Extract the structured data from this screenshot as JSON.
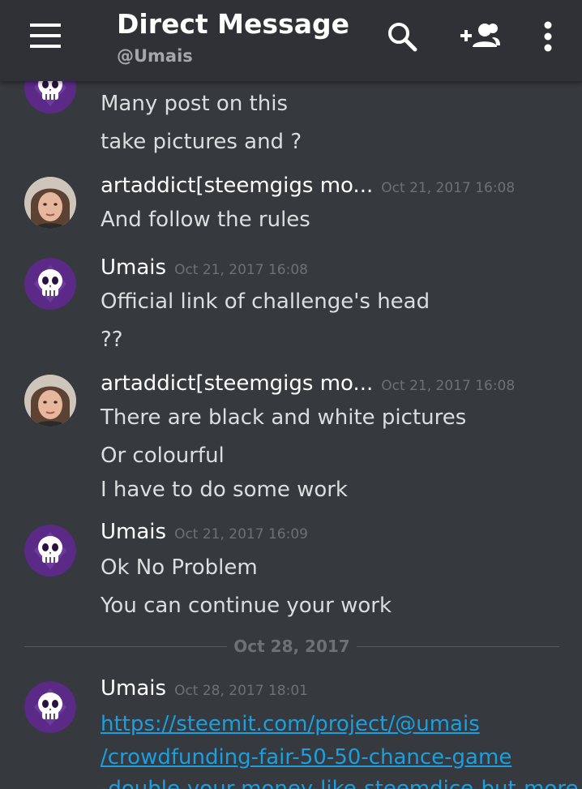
{
  "header": {
    "title": "Direct Message",
    "subtitle": "@Umais"
  },
  "messages": [
    {
      "lines": [
        "Many post on this",
        "take pictures and ?"
      ]
    },
    {
      "author": "artaddict[steemgigs mo...",
      "time": "Oct 21, 2017 16:08",
      "lines": [
        "And follow the rules"
      ]
    },
    {
      "author": "Umais",
      "time": "Oct 21, 2017 16:08",
      "lines": [
        "Official link of challenge's head",
        "??"
      ]
    },
    {
      "author": "artaddict[steemgigs mo...",
      "time": "Oct 21, 2017 16:08",
      "lines": [
        "There are black and white pictures",
        "Or colourful",
        "I have to do some work"
      ]
    },
    {
      "author": "Umais",
      "time": "Oct 21, 2017 16:09",
      "lines": [
        "Ok No Problem",
        "You can continue your work"
      ]
    },
    {
      "author": "Umais",
      "time": "Oct 28, 2017 18:01",
      "link_lines": [
        "https://steemit.com/project/@umais",
        "/crowdfunding-fair-50-50-chance-game",
        "-double-your-money-like-steemdice-but-more"
      ]
    }
  ],
  "date_divider": "Oct 28, 2017",
  "colors": {
    "background": "#36393e",
    "header": "#2f3136",
    "link": "#1a9fe0",
    "avatar_purple": "#5b2a86"
  }
}
